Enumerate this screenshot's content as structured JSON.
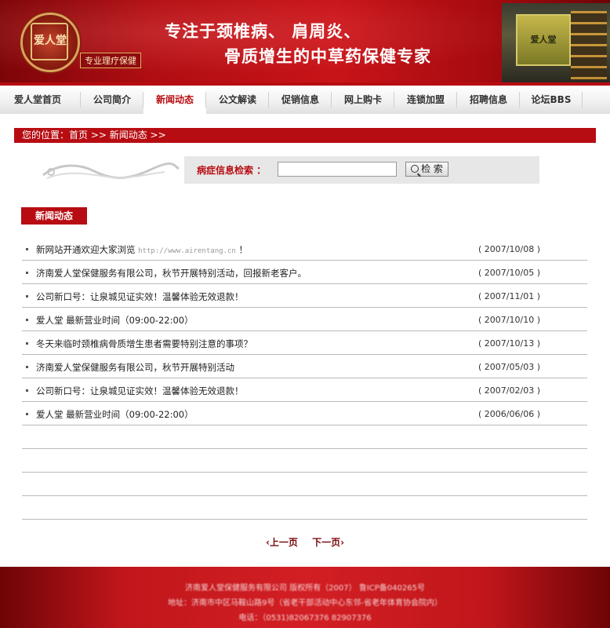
{
  "header": {
    "logo_text": "爱人堂",
    "logo_tag": "专业理疗保健",
    "slogan_line1": "专注于颈椎病、 肩周炎、",
    "slogan_line2": "骨质增生的中草药保健专家",
    "shop_sign": "爱人堂"
  },
  "nav": {
    "items": [
      {
        "label": "爱人堂首页"
      },
      {
        "label": "公司简介"
      },
      {
        "label": "新闻动态"
      },
      {
        "label": "公文解读"
      },
      {
        "label": "促销信息"
      },
      {
        "label": "网上购卡"
      },
      {
        "label": "连锁加盟"
      },
      {
        "label": "招聘信息"
      },
      {
        "label": "论坛BBS"
      }
    ],
    "active_index": 2
  },
  "breadcrumb": "您的位置：首页 >> 新闻动态 >>",
  "search": {
    "label": "病症信息检索 ：",
    "value": "",
    "button": "检 索"
  },
  "section_title": "新闻动态",
  "news": [
    {
      "title": "新网站开通欢迎大家浏览",
      "url": "http://www.airentang.cn",
      "suffix": "！",
      "date": "( 2007/10/08 )"
    },
    {
      "title": "济南爱人堂保健服务有限公司，秋节开展特别活动，回报新老客户。",
      "url": "",
      "suffix": "",
      "date": "( 2007/10/05 )"
    },
    {
      "title": "公司新口号：让泉城见证实效！温馨体验无效退款！",
      "url": "",
      "suffix": "",
      "date": "( 2007/11/01 )"
    },
    {
      "title": "爱人堂 最新营业时间（09:00-22:00）",
      "url": "",
      "suffix": "",
      "date": "( 2007/10/10 )"
    },
    {
      "title": "冬天来临时颈椎病骨质增生患者需要特别注意的事项？",
      "url": "",
      "suffix": "",
      "date": "( 2007/10/13 )"
    },
    {
      "title": "济南爱人堂保健服务有限公司，秋节开展特别活动",
      "url": "",
      "suffix": "",
      "date": "( 2007/05/03 )"
    },
    {
      "title": "公司新口号：让泉城见证实效！温馨体验无效退款！",
      "url": "",
      "suffix": "",
      "date": "( 2007/02/03 )"
    },
    {
      "title": "爱人堂 最新营业时间（09:00-22:00）",
      "url": "",
      "suffix": "",
      "date": "( 2006/06/06 )"
    },
    {
      "title": "",
      "url": "",
      "suffix": "",
      "date": ""
    },
    {
      "title": "",
      "url": "",
      "suffix": "",
      "date": ""
    },
    {
      "title": "",
      "url": "",
      "suffix": "",
      "date": ""
    },
    {
      "title": "",
      "url": "",
      "suffix": "",
      "date": ""
    }
  ],
  "pager": {
    "prev": "‹上一页",
    "next": "下一页›"
  },
  "footer": {
    "line1": "济南爱人堂保健服务有限公司  版权所有（2007）  鲁ICP备040265号",
    "line2": "地址：济南市中区马鞍山路9号（省老干部活动中心东邻-省老年体育协会院内）",
    "line3": "电话：（0531)82067376  82907376"
  },
  "colors": {
    "brand_red": "#b70d12",
    "header_dark": "#7c0508",
    "search_bg": "#e7e7e7"
  }
}
